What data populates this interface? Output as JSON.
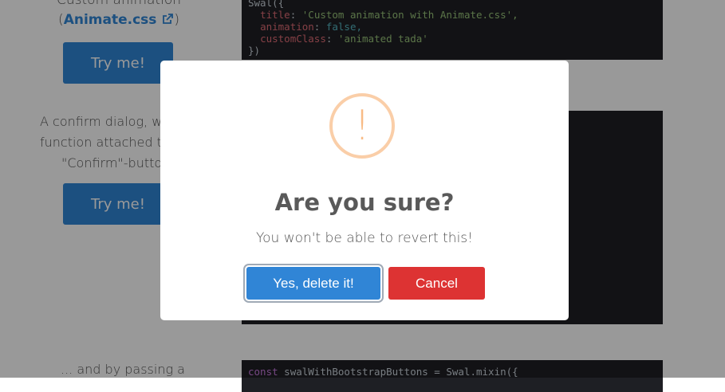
{
  "background": {
    "section1": {
      "lead_prefix": "Custom animation",
      "link_text": "Animate.css",
      "link_icon": "external-link-icon",
      "paren_open": "(",
      "paren_close": ")",
      "button_label": "Try me!"
    },
    "section2": {
      "lines": [
        "A confirm dialog, w",
        "function attached t",
        "\"Confirm\"-buttor"
      ],
      "button_label": "Try me!"
    },
    "section3": {
      "lead": "... and by passing a"
    },
    "code1": {
      "l1": "Swal({",
      "l2_key": "title",
      "l2_val": "'Custom animation with Animate.css',",
      "l3_key": "animation",
      "l3_val": "false,",
      "l4_key": "customClass",
      "l4_val": "'animated tada'",
      "l5": "})"
    },
    "code3": {
      "kw": "const",
      "rest": " swalWithBootstrapButtons = Swal.mixin({"
    }
  },
  "modal": {
    "icon": "warning-icon",
    "icon_glyph": "!",
    "title": "Are you sure?",
    "text": "You won't be able to revert this!",
    "confirm_label": "Yes, delete it!",
    "cancel_label": "Cancel"
  },
  "colors": {
    "confirm": "#3085d6",
    "cancel": "#dd3333",
    "warning": "#f8bb86",
    "code_bg": "#1e1f24"
  }
}
